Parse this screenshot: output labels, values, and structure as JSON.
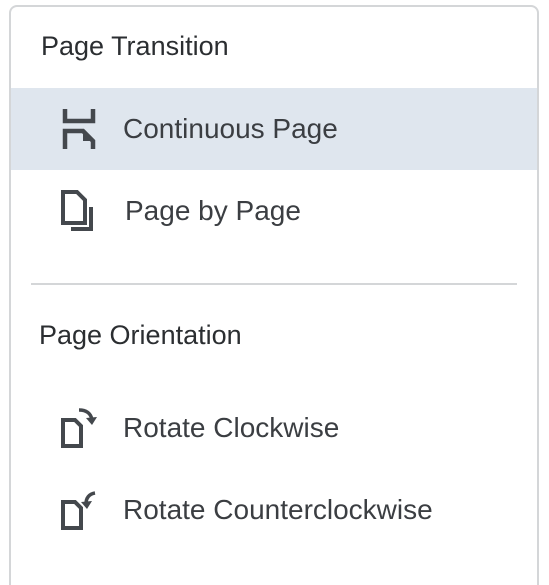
{
  "page_transition": {
    "title": "Page Transition",
    "items": [
      {
        "label": "Continuous Page",
        "icon": "continuous-page-icon",
        "selected": true
      },
      {
        "label": "Page by Page",
        "icon": "page-by-page-icon",
        "selected": false
      }
    ]
  },
  "page_orientation": {
    "title": "Page Orientation",
    "items": [
      {
        "label": "Rotate Clockwise",
        "icon": "rotate-clockwise-icon"
      },
      {
        "label": "Rotate Counterclockwise",
        "icon": "rotate-counterclockwise-icon"
      }
    ]
  },
  "colors": {
    "selected_background": "#dfe6ee",
    "icon": "#4a4e53",
    "border": "#d4d6d8"
  }
}
